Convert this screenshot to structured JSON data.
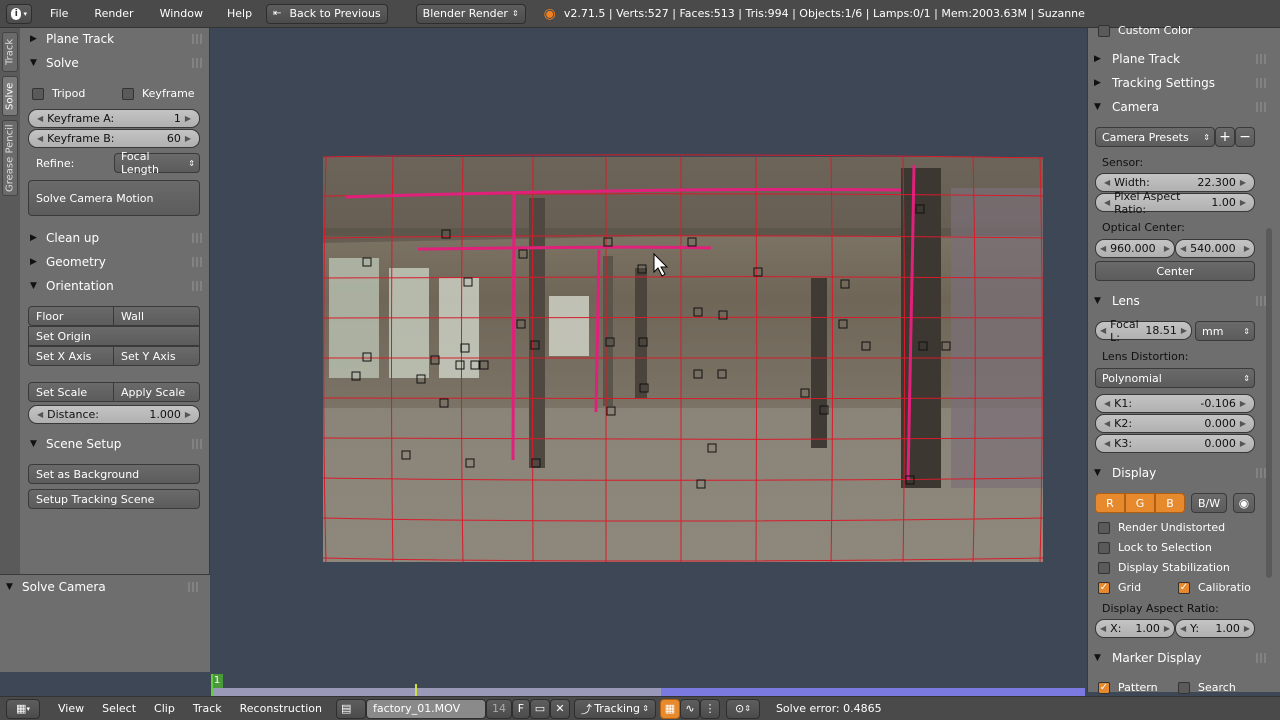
{
  "topbar": {
    "menus": [
      "File",
      "Render",
      "Window",
      "Help"
    ],
    "back_button": "Back to Previous",
    "engine": "Blender Render",
    "stats": "v2.71.5 | Verts:527 | Faces:513 | Tris:994 | Objects:1/6 | Lamps:0/1 | Mem:2003.63M | Suzanne"
  },
  "left_tabs": [
    "Track",
    "Solve",
    "Grease Pencil"
  ],
  "left": {
    "plane_track": "Plane Track",
    "solve": "Solve",
    "tripod": "Tripod",
    "keyframe": "Keyframe",
    "keyframe_a_label": "Keyframe A:",
    "keyframe_a": "1",
    "keyframe_b_label": "Keyframe B:",
    "keyframe_b": "60",
    "refine_label": "Refine:",
    "refine_value": "Focal Length",
    "solve_camera_motion": "Solve Camera Motion",
    "clean_up": "Clean up",
    "geometry": "Geometry",
    "orientation": "Orientation",
    "floor": "Floor",
    "wall": "Wall",
    "set_origin": "Set Origin",
    "set_x_axis": "Set X Axis",
    "set_y_axis": "Set Y Axis",
    "set_scale": "Set Scale",
    "apply_scale": "Apply Scale",
    "distance_label": "Distance:",
    "distance": "1.000",
    "scene_setup": "Scene Setup",
    "set_as_background": "Set as Background",
    "setup_tracking_scene": "Setup Tracking Scene",
    "solve_camera": "Solve Camera"
  },
  "right": {
    "custom_color": "Custom Color",
    "plane_track": "Plane Track",
    "tracking_settings": "Tracking Settings",
    "camera": "Camera",
    "camera_presets": "Camera Presets",
    "sensor_label": "Sensor:",
    "width_label": "Width:",
    "width": "22.300",
    "pixel_aspect_label": "Pixel Aspect Ratio:",
    "pixel_aspect": "1.00",
    "optical_center_label": "Optical Center:",
    "oc_x": "960.000",
    "oc_y": "540.000",
    "center": "Center",
    "lens": "Lens",
    "focal_label": "Focal L:",
    "focal": "18.51",
    "units": "mm",
    "lens_distortion_label": "Lens Distortion:",
    "distortion_model": "Polynomial",
    "k1_label": "K1:",
    "k1": "-0.106",
    "k2_label": "K2:",
    "k2": "0.000",
    "k3_label": "K3:",
    "k3": "0.000",
    "display": "Display",
    "r": "R",
    "g": "G",
    "b": "B",
    "bw": "B/W",
    "render_undistorted": "Render Undistorted",
    "lock_to_selection": "Lock to Selection",
    "display_stabilization": "Display Stabilization",
    "grid": "Grid",
    "calibration": "Calibratio",
    "display_aspect_label": "Display Aspect Ratio:",
    "aspect_x_label": "X:",
    "aspect_x": "1.00",
    "aspect_y_label": "Y:",
    "aspect_y": "1.00",
    "marker_display": "Marker Display",
    "pattern": "Pattern",
    "search": "Search"
  },
  "timeline": {
    "frame": "1"
  },
  "bottombar": {
    "menus": [
      "View",
      "Select",
      "Clip",
      "Track",
      "Reconstruction"
    ],
    "clip_name": "factory_01.MOV",
    "frame_field": "14",
    "f_label": "F",
    "mode": "Tracking",
    "solve_error": "Solve error: 0.4865"
  },
  "colors": {
    "accent": "#e7892d",
    "panel": "#6e6e6e",
    "viewport": "#3d4756",
    "grid_line": "#d81b2a",
    "track_line": "#e0207a"
  }
}
